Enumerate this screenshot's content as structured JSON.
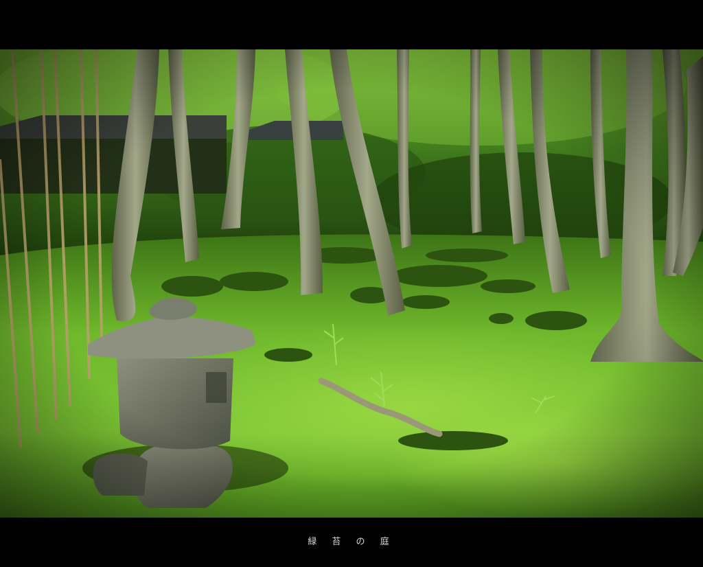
{
  "caption": "緑 苔 の 庭",
  "colors": {
    "frame": "#000000",
    "moss_light": "#8fd23a",
    "moss_mid": "#5fa623",
    "moss_dark": "#2c5410",
    "foliage": "#3f7a1c",
    "trunk": "#8a8f6a",
    "stone": "#6f7362",
    "caption_text": "#d8d8d8"
  },
  "icons": [
    "stone-lantern",
    "tree-trunk",
    "bamboo-stalk",
    "moss-mound",
    "roof"
  ]
}
